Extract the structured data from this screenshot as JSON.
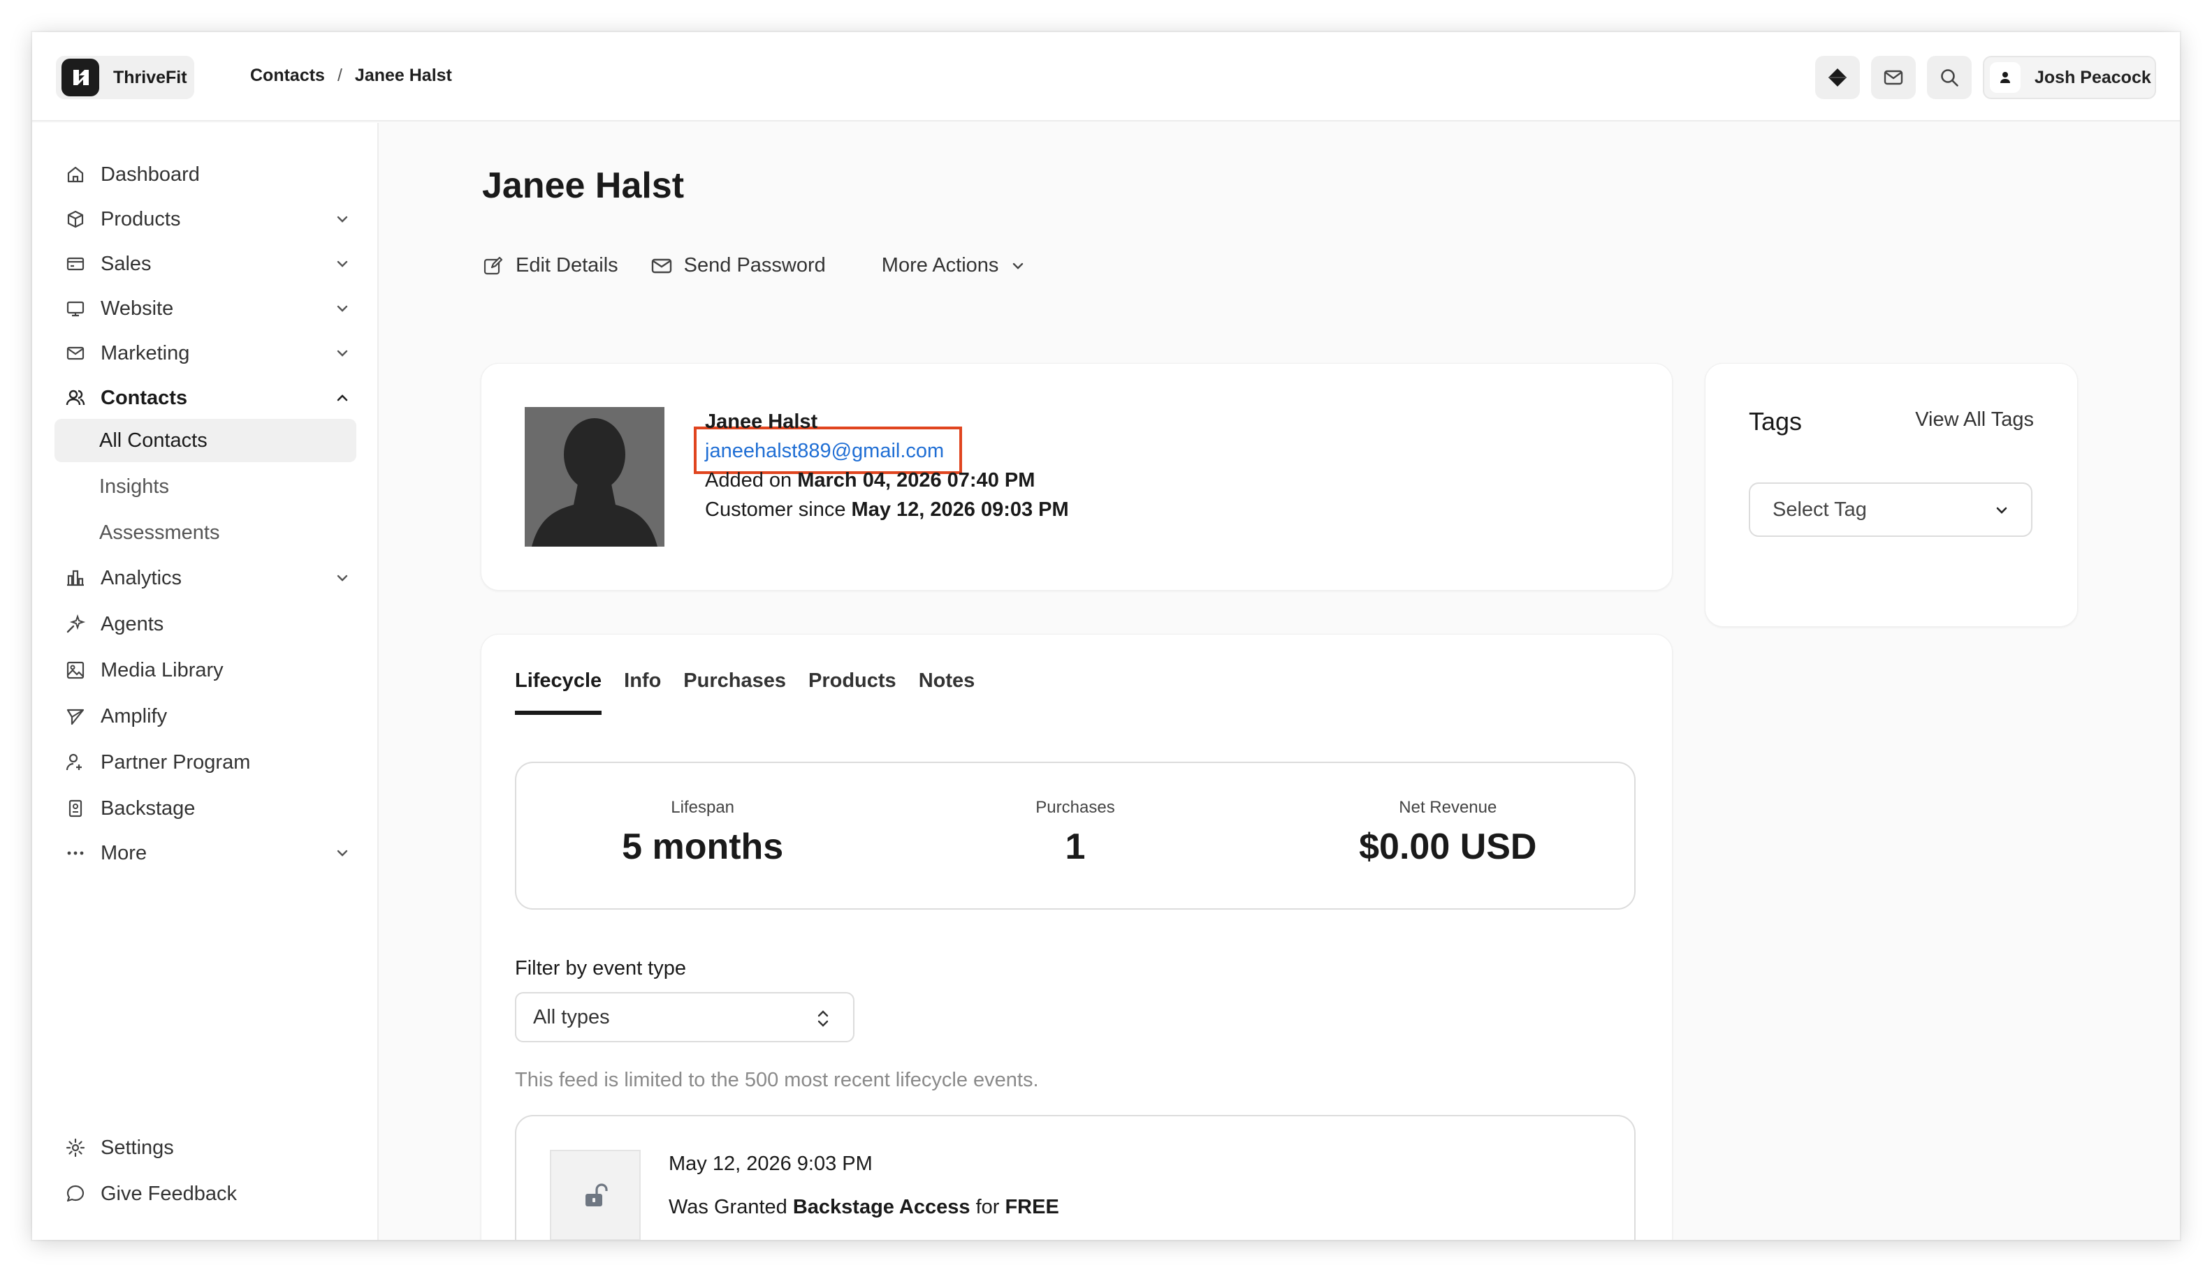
{
  "brand": {
    "name": "ThriveFit"
  },
  "breadcrumb": {
    "parent": "Contacts",
    "separator": "/",
    "current": "Janee Halst"
  },
  "user": {
    "name": "Josh Peacock"
  },
  "sidebar": {
    "items": [
      {
        "label": "Dashboard",
        "icon": "home-icon"
      },
      {
        "label": "Products",
        "icon": "box-icon"
      },
      {
        "label": "Sales",
        "icon": "credit-card-icon"
      },
      {
        "label": "Website",
        "icon": "monitor-icon"
      },
      {
        "label": "Marketing",
        "icon": "mail-icon"
      },
      {
        "label": "Contacts",
        "icon": "users-icon"
      },
      {
        "label": "Analytics",
        "icon": "bar-chart-icon"
      },
      {
        "label": "Agents",
        "icon": "sparkle-icon"
      },
      {
        "label": "Media Library",
        "icon": "image-icon"
      },
      {
        "label": "Amplify",
        "icon": "send-icon"
      },
      {
        "label": "Partner Program",
        "icon": "partner-icon"
      },
      {
        "label": "Backstage",
        "icon": "badge-icon"
      },
      {
        "label": "More",
        "icon": "more-dots-icon"
      }
    ],
    "sub_items": [
      "All Contacts",
      "Insights",
      "Assessments"
    ],
    "footer": [
      "Settings",
      "Give Feedback"
    ]
  },
  "page": {
    "title": "Janee Halst",
    "actions": {
      "edit": "Edit Details",
      "send_password": "Send Password",
      "more": "More Actions"
    }
  },
  "profile": {
    "name": "Janee Halst",
    "email": "janeehalst889@gmail.com",
    "added_prefix": "Added on",
    "added_date": "March 04, 2026 07:40 PM",
    "customer_prefix": "Customer since",
    "customer_date": "May 12, 2026 09:03 PM"
  },
  "tags": {
    "title": "Tags",
    "view_all": "View All Tags",
    "select_placeholder": "Select Tag"
  },
  "tabs": [
    "Lifecycle",
    "Info",
    "Purchases",
    "Products",
    "Notes"
  ],
  "stats": [
    {
      "label": "Lifespan",
      "value": "5 months"
    },
    {
      "label": "Purchases",
      "value": "1"
    },
    {
      "label": "Net Revenue",
      "value": "$0.00 USD"
    }
  ],
  "filter": {
    "label": "Filter by event type",
    "value": "All types",
    "note": "This feed is limited to the 500 most recent lifecycle events."
  },
  "event": {
    "date": "May 12, 2026 9:03 PM",
    "prefix": "Was Granted",
    "item": "Backstage Access",
    "middle": "for",
    "price": "FREE"
  }
}
